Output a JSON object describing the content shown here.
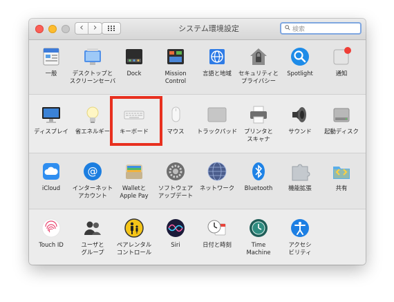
{
  "window": {
    "title": "システム環境設定",
    "search_placeholder": "検索"
  },
  "rows": [
    {
      "items": [
        {
          "label": "一般",
          "icon": "general-icon"
        },
        {
          "label": "デスクトップと\nスクリーンセーバ",
          "icon": "desktop-icon"
        },
        {
          "label": "Dock",
          "icon": "dock-icon"
        },
        {
          "label": "Mission\nControl",
          "icon": "mission-control-icon"
        },
        {
          "label": "言語と地域",
          "icon": "globe-flag-icon"
        },
        {
          "label": "セキュリティと\nプライバシー",
          "icon": "security-house-icon"
        },
        {
          "label": "Spotlight",
          "icon": "spotlight-icon"
        },
        {
          "label": "通知",
          "icon": "notifications-icon"
        }
      ]
    },
    {
      "items": [
        {
          "label": "ディスプレイ",
          "icon": "display-icon"
        },
        {
          "label": "省エネルギー",
          "icon": "lightbulb-icon"
        },
        {
          "label": "キーボード",
          "icon": "keyboard-icon"
        },
        {
          "label": "マウス",
          "icon": "mouse-icon"
        },
        {
          "label": "トラックパッド",
          "icon": "trackpad-icon"
        },
        {
          "label": "プリンタと\nスキャナ",
          "icon": "printer-icon"
        },
        {
          "label": "サウンド",
          "icon": "speaker-icon"
        },
        {
          "label": "起動ディスク",
          "icon": "disk-icon"
        }
      ]
    },
    {
      "items": [
        {
          "label": "iCloud",
          "icon": "icloud-icon"
        },
        {
          "label": "インターネット\nアカウント",
          "icon": "at-sign-icon"
        },
        {
          "label": "Walletと\nApple Pay",
          "icon": "wallet-icon"
        },
        {
          "label": "ソフトウェア\nアップデート",
          "icon": "gear-icon"
        },
        {
          "label": "ネットワーク",
          "icon": "network-globe-icon"
        },
        {
          "label": "Bluetooth",
          "icon": "bluetooth-icon"
        },
        {
          "label": "機能拡張",
          "icon": "puzzle-icon"
        },
        {
          "label": "共有",
          "icon": "sharing-folder-icon"
        }
      ]
    },
    {
      "items": [
        {
          "label": "Touch ID",
          "icon": "fingerprint-icon"
        },
        {
          "label": "ユーザと\nグループ",
          "icon": "users-icon"
        },
        {
          "label": "ペアレンタル\nコントロール",
          "icon": "parental-icon"
        },
        {
          "label": "Siri",
          "icon": "siri-icon"
        },
        {
          "label": "日付と時刻",
          "icon": "calendar-clock-icon"
        },
        {
          "label": "Time\nMachine",
          "icon": "time-machine-icon"
        },
        {
          "label": "アクセシ\nビリティ",
          "icon": "accessibility-icon"
        }
      ]
    }
  ],
  "colors": {
    "highlight": "#e8301f",
    "search_focus": "#7ea6e0"
  }
}
